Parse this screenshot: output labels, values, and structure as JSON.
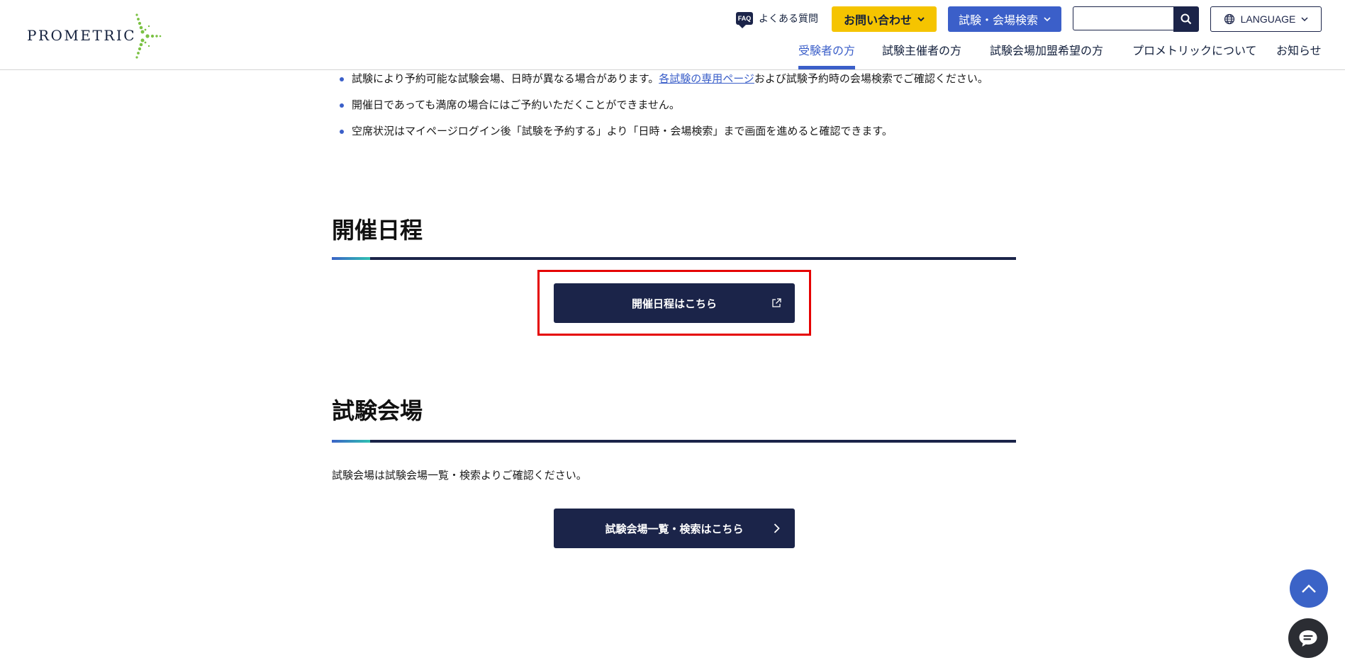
{
  "header": {
    "logo_text": "PROMETRIC",
    "faq": {
      "icon_text": "FAQ",
      "label": "よくある質問"
    },
    "contact_button": "お問い合わせ",
    "venue_search_button": "試験・会場検索",
    "search": {
      "placeholder": ""
    },
    "language_button": "LANGUAGE",
    "nav": [
      {
        "label": "受験者の方",
        "active": true
      },
      {
        "label": "試験主催者の方",
        "active": false
      },
      {
        "label": "試験会場加盟希望の方",
        "active": false
      },
      {
        "label": "プロメトリックについて",
        "active": false
      },
      {
        "label": "お知らせ",
        "active": false
      }
    ]
  },
  "notes": {
    "item1_before": "試験により予約可能な試験会場、日時が異なる場合があります。",
    "item1_link": "各試験の専用ページ",
    "item1_after": "および試験予約時の会場検索でご確認ください。",
    "item2": "開催日であっても満席の場合にはご予約いただくことができません。",
    "item3": "空席状況はマイページログイン後「試験を予約する」より「日時・会場検索」まで画面を進めると確認できます。"
  },
  "schedule": {
    "title": "開催日程",
    "button": "開催日程はこちら"
  },
  "venue": {
    "title": "試験会場",
    "text": "試験会場は試験会場一覧・検索よりご確認ください。",
    "button": "試験会場一覧・検索はこちら"
  },
  "colors": {
    "navy": "#1b2449",
    "accent_blue": "#3b5fc9",
    "yellow": "#f5c400",
    "highlight_red": "#e50000",
    "logo_green": "#7ac143"
  }
}
